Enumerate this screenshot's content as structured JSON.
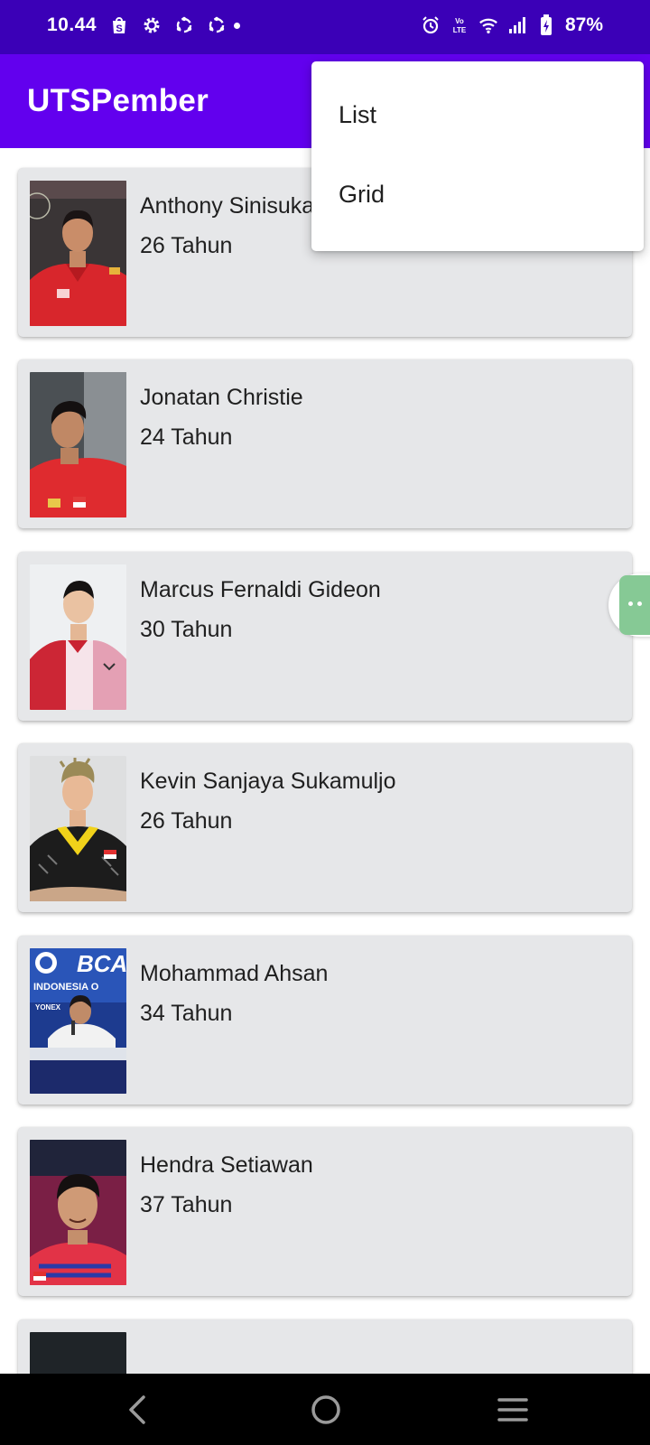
{
  "status_bar": {
    "time": "10.44",
    "battery": "87%",
    "left_icons": [
      "shopee-icon",
      "gear-icon",
      "sync-icon",
      "sync-icon"
    ],
    "right_icons": [
      "alarm-icon",
      "volte-icon",
      "wifi-icon",
      "signal-icon",
      "battery-charging-icon"
    ]
  },
  "app_bar": {
    "title": "UTSPember",
    "background": "#6200ee"
  },
  "menu": {
    "items": [
      {
        "label": "List"
      },
      {
        "label": "Grid"
      }
    ]
  },
  "players": [
    {
      "name": "Anthony Sinisuka Ginting",
      "age": "26 Tahun"
    },
    {
      "name": "Jonatan Christie",
      "age": "24 Tahun"
    },
    {
      "name": "Marcus Fernaldi Gideon",
      "age": "30 Tahun"
    },
    {
      "name": "Kevin Sanjaya Sukamuljo",
      "age": "26 Tahun"
    },
    {
      "name": "Mohammad Ahsan",
      "age": "34 Tahun"
    },
    {
      "name": "Hendra Setiawan",
      "age": "37 Tahun"
    },
    {
      "name": "",
      "age": ""
    }
  ],
  "photo_captions": {
    "ahsan_banner": "BCA",
    "ahsan_banner_sub": "INDONESIA O",
    "ahsan_sponsor": "YONEX"
  },
  "colors": {
    "status_bar": "#3b00b7",
    "accent": "#6200ee",
    "card": "#e6e7e9"
  },
  "nav_bar": {
    "buttons": [
      "back-icon",
      "home-icon",
      "recents-icon"
    ]
  }
}
